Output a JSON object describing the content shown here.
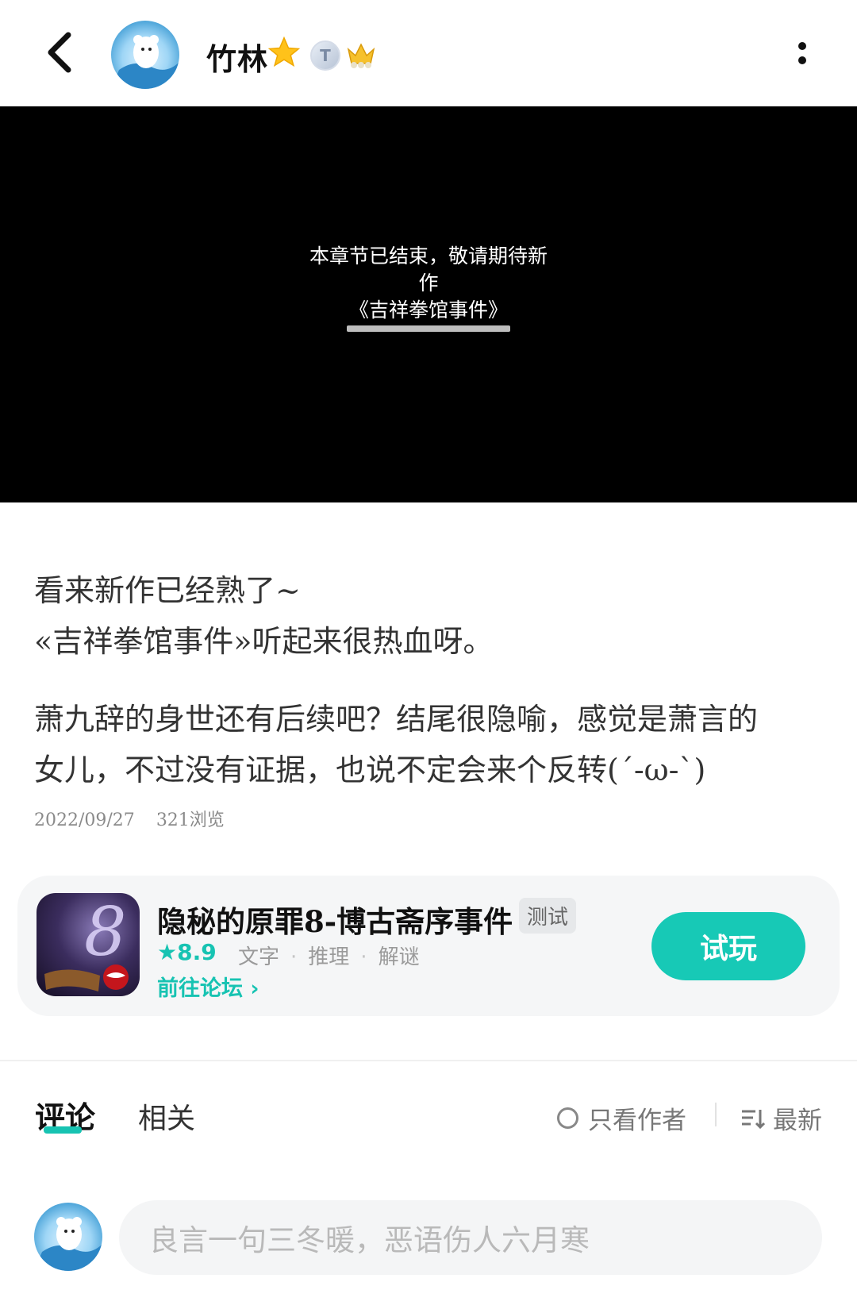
{
  "header": {
    "username": "竹林",
    "badge_t_text": "T",
    "icons": [
      "back-arrow-icon",
      "avatar",
      "star-icon",
      "t-level-badge",
      "crown-icon",
      "more-vertical-icon"
    ]
  },
  "video": {
    "line1": "本章节已结束，敬请期待新",
    "line2": "作",
    "line3": "《吉祥拳馆事件》"
  },
  "post": {
    "para1_line1": "看来新作已经熟了~",
    "para1_line2": "«吉祥拳馆事件»听起来很热血呀。",
    "para2_line1": "萧九辞的身世还有后续吧？结尾很隐喻，感觉是萧言的",
    "para2_line2": "女儿，不过没有证据，也说不定会来个反转(´-ω-`)",
    "date": "2022/09/27",
    "views": "321浏览"
  },
  "game_card": {
    "title": "隐秘的原罪8-博古斋序事件",
    "tag": "测试",
    "rating": "★8.9",
    "category1": "文字",
    "category2": "推理",
    "category3": "解谜",
    "forum_link": "前往论坛 ›",
    "play_button": "试玩",
    "accent_color": "#17c3b2"
  },
  "tabs": {
    "comment": "评论",
    "related": "相关",
    "author_only": "只看作者",
    "sort": "最新"
  },
  "comment_box": {
    "placeholder": "良言一句三冬暖，恶语伤人六月寒"
  }
}
